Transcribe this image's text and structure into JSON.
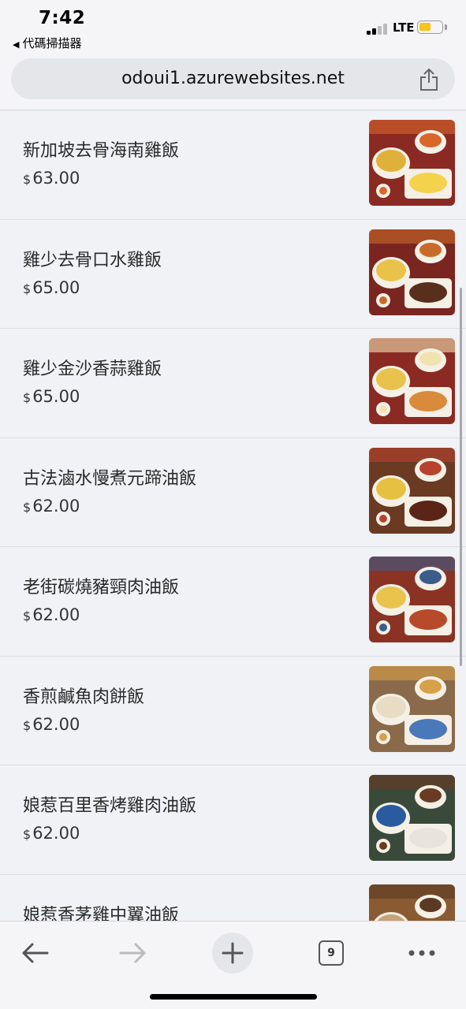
{
  "status_bar": {
    "time": "7:42",
    "back_app": "代碼掃描器",
    "network": "LTE",
    "battery_color": "#f5c518"
  },
  "browser": {
    "url": "odoui1.azurewebsites.net",
    "share_icon": "share-icon",
    "tab_count": "9",
    "toolbar_icons": [
      "back-arrow-icon",
      "forward-arrow-icon",
      "new-tab-plus-icon",
      "tabs-icon",
      "more-icon"
    ]
  },
  "menu": {
    "currency_symbol": "$",
    "items": [
      {
        "name": "新加坡去骨海南雞飯",
        "price": "63.00"
      },
      {
        "name": "雞少去骨口水雞飯",
        "price": "65.00"
      },
      {
        "name": "雞少金沙香蒜雞飯",
        "price": "65.00"
      },
      {
        "name": "古法滷水慢煮元蹄油飯",
        "price": "62.00"
      },
      {
        "name": "老街碳燒豬頸肉油飯",
        "price": "62.00"
      },
      {
        "name": "香煎鹹魚肉餅飯",
        "price": "62.00"
      },
      {
        "name": "娘惹百里香烤雞肉油飯",
        "price": "62.00"
      },
      {
        "name": "娘惹香茅雞中翼油飯",
        "price": ""
      }
    ]
  }
}
